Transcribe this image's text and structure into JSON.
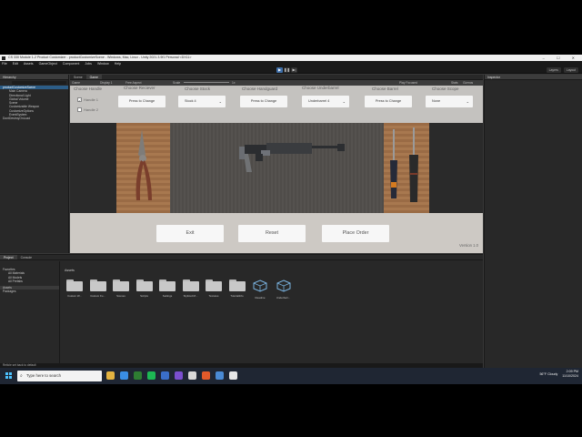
{
  "window": {
    "title": "CS 330 Module 1-2 Product Customizer - productCustomizeScene - Windows, Mac, Linux - Unity 2021.3.9f1 Personal <DX11>",
    "controls": "–  ☐  ✕"
  },
  "menu": [
    "File",
    "Edit",
    "Assets",
    "GameObject",
    "Component",
    "Jobs",
    "Window",
    "Help"
  ],
  "toolbar": {
    "play": "▶",
    "pause": "❚❚",
    "step": "▶|",
    "layers": "Layers",
    "layout": "Layout"
  },
  "hierarchy": {
    "tab": "Hierarchy",
    "items": [
      "productCustomizeScene",
      "Main Camera",
      "Directional Light",
      "Global Volume",
      "Scene",
      "Customizable Weapon",
      "CustomizeOptions",
      "EventSystem",
      "DontDestroyOnLoad"
    ]
  },
  "game": {
    "tabs": [
      "Scene",
      "Game"
    ],
    "bar": {
      "mode": "Game",
      "display": "Display 1",
      "aspect": "Free Aspect",
      "scale": "Scale",
      "scale_value": "1x",
      "play_focused": "Play Focused",
      "stats": "Stats",
      "gizmos": "Gizmos"
    },
    "categories": [
      "Choose Handle",
      "Choose Reciever",
      "Choose Stock",
      "Choose Handguard",
      "Choose Underbarrel",
      "Choose Barrel",
      "Choose Scope"
    ],
    "handles": [
      {
        "label": "Handle 1",
        "checked": true
      },
      {
        "label": "Handle 2",
        "checked": false
      }
    ],
    "buttons": {
      "reciever": "Press to Change",
      "stock": "Stock 4",
      "handguard": "Press to Change",
      "underbarrel": "Underbarrel 4",
      "barrel": "Press to Change",
      "scope": "None"
    },
    "actions": [
      "Exit",
      "Reset",
      "Place Order"
    ],
    "version": "Version 1.0"
  },
  "inspector": {
    "tab": "Inspector"
  },
  "project": {
    "tabs": [
      "Project",
      "Console"
    ],
    "tree": [
      "Favorites",
      "All Materials",
      "All Models",
      "All Prefabs",
      "Assets",
      "Packages"
    ],
    "breadcrumb": "Assets",
    "assets": [
      "Custom W...",
      "Custom Fu...",
      "Scenes",
      "Scripts",
      "Settings",
      "Stylized M...",
      "Textures",
      "TutorialInfo",
      "Readme",
      "Underbarr..."
    ]
  },
  "status": "Reticle set back to default",
  "taskbar": {
    "search_placeholder": "Type here to search",
    "weather": "56°F  Cloudy",
    "time": "2:09 PM",
    "date": "11/10/2024"
  },
  "colors": {
    "accent": "#3e6ea8",
    "selected_row": "#2c5d87",
    "wood": "#a8784f"
  }
}
